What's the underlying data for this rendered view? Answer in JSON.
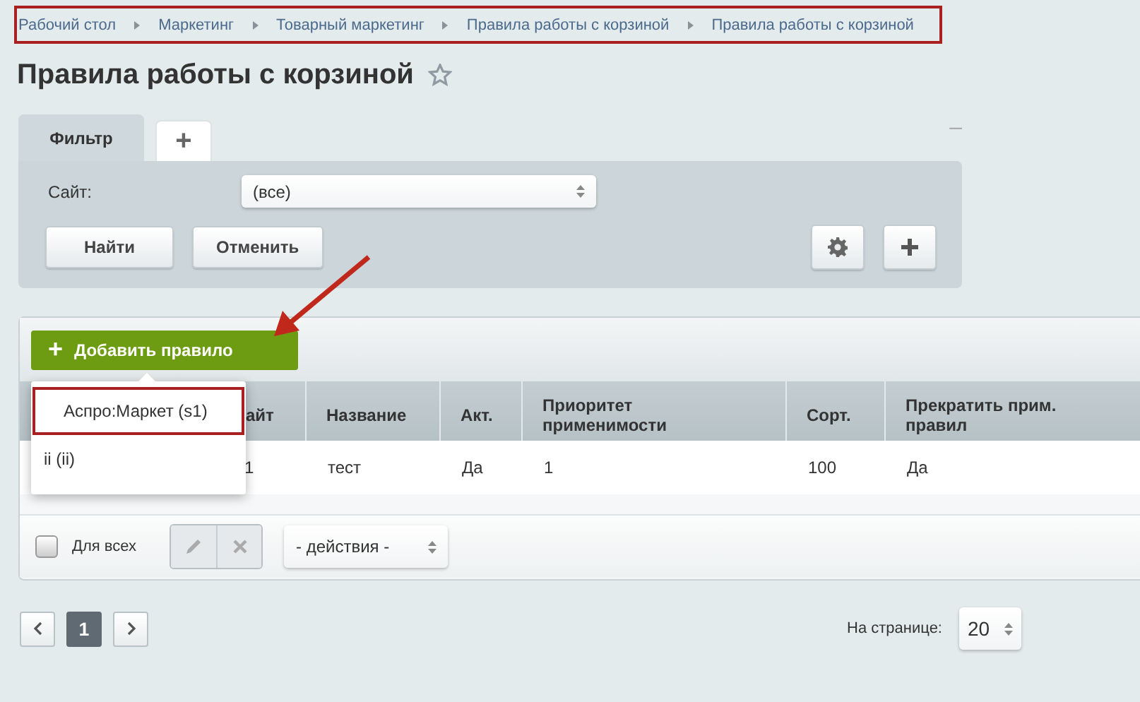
{
  "breadcrumbs": [
    "Рабочий стол",
    "Маркетинг",
    "Товарный маркетинг",
    "Правила работы с корзиной",
    "Правила работы с корзиной"
  ],
  "title": "Правила работы с корзиной",
  "filter": {
    "tabs": [
      {
        "label": "Фильтр",
        "selected": true
      },
      {
        "label": "+",
        "selected": false
      }
    ],
    "collapse": "–",
    "fields": [
      {
        "label": "Сайт:",
        "value": "(все)"
      }
    ],
    "buttons": [
      "Найти",
      "Отменить"
    ]
  },
  "add_button": {
    "label": "Добавить правило",
    "icon": "+"
  },
  "add_menu": [
    {
      "label": "Аспро:Маркет (s1)",
      "selected": true
    },
    {
      "label": "ii (ii)",
      "selected": false
    }
  ],
  "table": {
    "columns": [
      "айт",
      "Название",
      "Акт.",
      "Приоритет применимости",
      "Сорт.",
      "Прекратить прим. правил"
    ],
    "rows": [
      [
        "1",
        "тест",
        "Да",
        "1",
        "100",
        "Да"
      ]
    ]
  },
  "footer": {
    "for_all": {
      "label": "Для всех",
      "checked": false
    },
    "actions": "- действия -"
  },
  "pagination": {
    "pages": [
      {
        "label": "1",
        "selected": true
      }
    ],
    "per_page_label": "На странице:",
    "per_page": "20"
  }
}
